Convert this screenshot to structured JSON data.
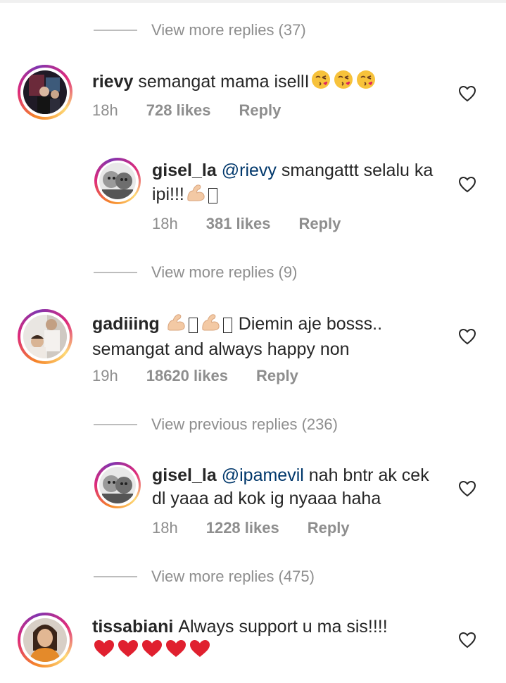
{
  "view_more": [
    {
      "label": "View more replies (37)"
    },
    {
      "label": "View more replies (9)"
    },
    {
      "label": "View previous replies (236)"
    },
    {
      "label": "View more replies (475)"
    }
  ],
  "comments": [
    {
      "username": "rievy",
      "text": "semangat mama isellI",
      "time": "18h",
      "likes": "728 likes",
      "reply": "Reply"
    },
    {
      "username": "gisel_la",
      "mention": "@rievy",
      "text": "smangattt selalu ka ipi!!!",
      "time": "18h",
      "likes": "381 likes",
      "reply": "Reply"
    },
    {
      "username": "gadiiing",
      "text_tail": "Diemin aje bosss..",
      "text_line2": "semangat and always happy non",
      "time": "19h",
      "likes": "18620 likes",
      "reply": "Reply"
    },
    {
      "username": "gisel_la",
      "mention": "@ipamevil",
      "text": "nah bntr ak cek dl yaaa ad kok ig nyaaa haha",
      "time": "18h",
      "likes": "1228 likes",
      "reply": "Reply"
    },
    {
      "username": "tissabiani",
      "text": "Always support u ma sis!!!!"
    }
  ],
  "icons": {
    "heart_outline": "heart-icon",
    "kiss_emoji": "kissing-face-emoji",
    "muscle_emoji": "flexed-biceps-emoji",
    "red_heart_emoji": "red-heart-emoji"
  },
  "colors": {
    "text": "#262626",
    "meta": "#8e8e8e",
    "mention": "#00376b",
    "story_ring_start": "#f58529",
    "story_ring_mid": "#dd2a7b"
  }
}
